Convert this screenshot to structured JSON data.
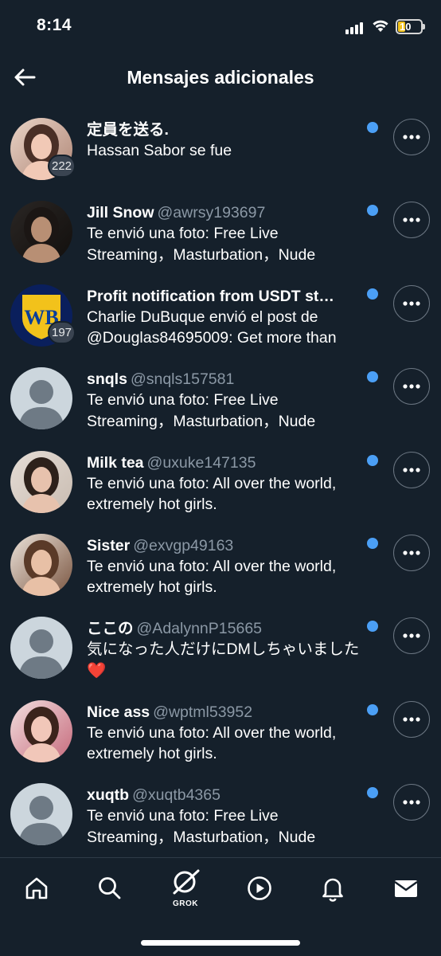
{
  "status_bar": {
    "time": "8:14",
    "battery": "10"
  },
  "header": {
    "title": "Mensajes adicionales"
  },
  "messages": [
    {
      "name": "定員を送る.",
      "handle": "",
      "snippet": "Hassan Sabor se fue",
      "badge": "222",
      "avatar": "photo-woman-1",
      "unread": true
    },
    {
      "name": "Jill Snow",
      "handle": "@awrsy193697",
      "snippet": "Te envió una foto: Free Live\nStreaming，Masturbation，Nude",
      "badge": "",
      "avatar": "photo-woman-dark",
      "unread": true
    },
    {
      "name": "Profit notification from USDT st…",
      "handle": "",
      "snippet": "Charlie DuBuque envió el post de\n@Douglas84695009: Get more than",
      "badge": "197",
      "avatar": "wb-logo",
      "unread": true
    },
    {
      "name": "snqls",
      "handle": "@snqls157581",
      "snippet": "Te envió una foto: Free Live\nStreaming，Masturbation，Nude",
      "badge": "",
      "avatar": "default",
      "unread": true
    },
    {
      "name": "Milk tea",
      "handle": "@uxuke147135",
      "snippet": "Te envió una foto: All over the world,\nextremely hot girls.",
      "badge": "",
      "avatar": "photo-woman-2",
      "unread": true
    },
    {
      "name": "Sister",
      "handle": "@exvgp49163",
      "snippet": "Te envió una foto: All over the world,\nextremely hot girls.",
      "badge": "",
      "avatar": "photo-woman-3",
      "unread": true
    },
    {
      "name": "ここの",
      "handle": "@AdalynnP15665",
      "snippet": "気になった人だけにDMしちゃいました\n❤️",
      "badge": "",
      "avatar": "default",
      "unread": true
    },
    {
      "name": "Nice ass",
      "handle": "@wptml53952",
      "snippet": "Te envió una foto: All over the world,\nextremely hot girls.",
      "badge": "",
      "avatar": "photo-woman-4",
      "unread": true
    },
    {
      "name": "xuqtb",
      "handle": "@xuqtb4365",
      "snippet": "Te envió una foto: Free Live\nStreaming，Masturbation，Nude",
      "badge": "",
      "avatar": "default",
      "unread": true
    }
  ],
  "tabbar": {
    "tabs": [
      {
        "name": "home",
        "icon": "home-icon"
      },
      {
        "name": "search",
        "icon": "search-icon"
      },
      {
        "name": "grok",
        "icon": "grok-icon",
        "label": "GROK"
      },
      {
        "name": "video",
        "icon": "play-icon"
      },
      {
        "name": "notifications",
        "icon": "bell-icon"
      },
      {
        "name": "messages",
        "icon": "mail-icon"
      }
    ]
  },
  "colors": {
    "background": "#15202b",
    "unread_dot": "#4b9ff5",
    "handle": "#8b98a5",
    "battery": "#f2c21b"
  }
}
